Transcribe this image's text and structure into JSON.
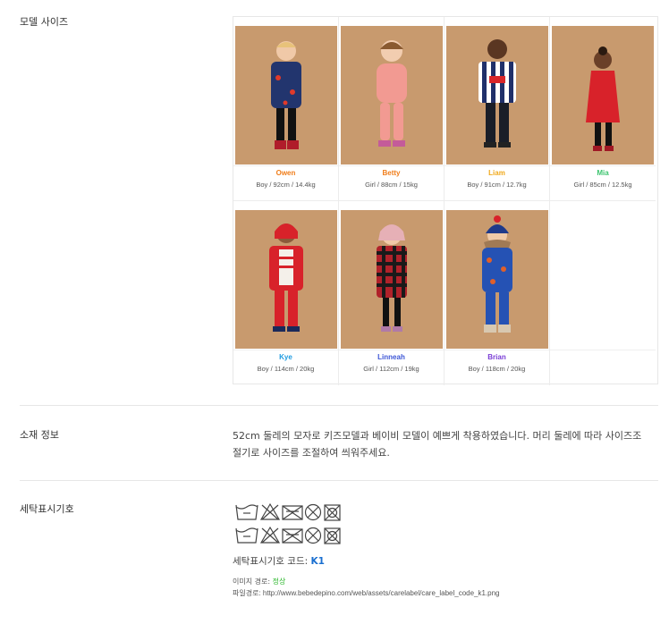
{
  "sections": {
    "model_size_label": "모델 사이즈",
    "material_label": "소재 정보",
    "care_label": "세탁표시기호"
  },
  "models": [
    {
      "name": "Owen",
      "size": "Boy / 92cm / 14.4kg",
      "color": "#f07d1a",
      "figure": "jacket-navy"
    },
    {
      "name": "Betty",
      "size": "Girl / 88cm / 15kg",
      "color": "#f07d1a",
      "figure": "pink-set"
    },
    {
      "name": "Liam",
      "size": "Boy / 91cm / 12.7kg",
      "color": "#f0a81a",
      "figure": "striped-sweater"
    },
    {
      "name": "Mia",
      "size": "Girl / 85cm / 12.5kg",
      "color": "#3cc46e",
      "figure": "red-dress"
    },
    {
      "name": "Kye",
      "size": "Boy / 114cm / 20kg",
      "color": "#1e9be0",
      "figure": "red-hoodie"
    },
    {
      "name": "Linneah",
      "size": "Girl / 112cm / 19kg",
      "color": "#3d56d6",
      "figure": "plaid-coat"
    },
    {
      "name": "Brian",
      "size": "Boy / 118cm / 20kg",
      "color": "#7a3dd6",
      "figure": "blue-snowsuit"
    }
  ],
  "material": {
    "text": "52cm 둘레의 모자로 키즈모델과 베이비 모델이 예쁘게 착용하였습니다. 머리 둘레에 따라 사이즈조절기로 사이즈를 조절하여 씌워주세요."
  },
  "care": {
    "code_prefix": "세탁표시기호 코드: ",
    "code": "K1",
    "image_path_label": "이미지 경로: ",
    "image_path_status": "정상",
    "file_path_label": "파일경로: ",
    "file_path": "http://www.bebedepino.com/web/assets/carelabel/care_label_code_k1.png",
    "icons": [
      "hand-wash-icon",
      "no-bleach-icon",
      "no-tumble-dry-icon",
      "no-dry-clean-icon",
      "no-iron-icon"
    ]
  }
}
